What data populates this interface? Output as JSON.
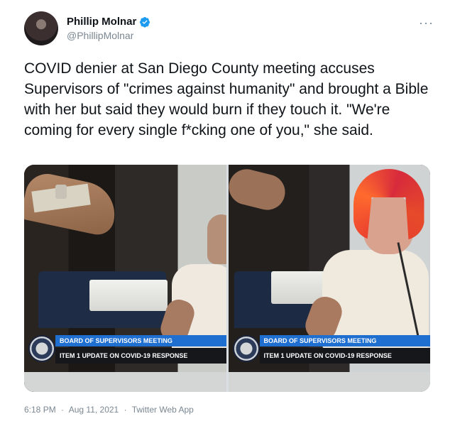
{
  "tweet": {
    "author": {
      "display_name": "Phillip Molnar",
      "handle": "@PhillipMolnar",
      "verified_color": "#1d9bf0"
    },
    "more_label": "···",
    "text": "COVID denier at San Diego County meeting accuses Supervisors of \"crimes against humanity\" and brought a Bible with her but said they would burn if they touch it. \"We're coming for every single f*cking one of you,\" she said.",
    "media": {
      "frames": [
        {
          "lower_third_title": "BOARD OF SUPERVISORS MEETING",
          "lower_third_sub": "ITEM 1 UPDATE ON COVID-19 RESPONSE"
        },
        {
          "lower_third_title": "BOARD OF SUPERVISORS MEETING",
          "lower_third_sub": "ITEM 1 UPDATE ON COVID-19 RESPONSE"
        }
      ]
    },
    "meta": {
      "time": "6:18 PM",
      "separator": "·",
      "date": "Aug 11, 2021",
      "source": "Twitter Web App"
    }
  }
}
